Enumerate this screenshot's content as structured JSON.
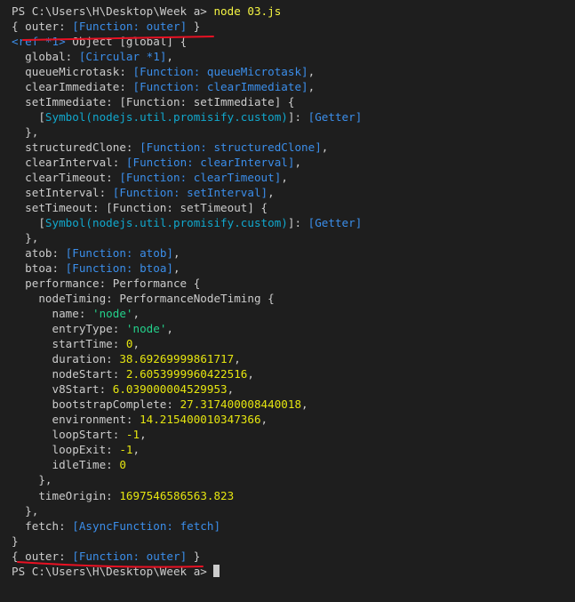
{
  "terminal": {
    "colors": {
      "background": "#1e1e1e",
      "text": "#cccccc",
      "function": "#3b8eea",
      "string": "#23d18b",
      "symbol": "#11a8cd",
      "number": "#e5e510",
      "annotation": "#e81123"
    },
    "prompt": "PS C:\\Users\\H\\Desktop\\Week a> ",
    "command": "node 03.js",
    "lines": [
      [
        [
          "",
          "PS C:\\Users\\H\\Desktop\\Week a> "
        ],
        [
          "cmd",
          "node 03.js"
        ]
      ],
      [
        [
          "",
          "{ outer: "
        ],
        [
          "c",
          "[Function: outer]"
        ],
        [
          "",
          " }"
        ]
      ],
      [
        [
          "c",
          "<ref *1>"
        ],
        [
          "",
          " Object [global] {"
        ]
      ],
      [
        [
          "",
          "  global: "
        ],
        [
          "c",
          "[Circular *1]"
        ],
        [
          "",
          ","
        ]
      ],
      [
        [
          "",
          "  queueMicrotask: "
        ],
        [
          "c",
          "[Function: queueMicrotask]"
        ],
        [
          "",
          ","
        ]
      ],
      [
        [
          "",
          "  clearImmediate: "
        ],
        [
          "c",
          "[Function: clearImmediate]"
        ],
        [
          "",
          ","
        ]
      ],
      [
        [
          "",
          "  setImmediate: [Function: setImmediate] {"
        ]
      ],
      [
        [
          "",
          "    ["
        ],
        [
          "t",
          "Symbol(nodejs.util.promisify.custom)"
        ],
        [
          "",
          "]: "
        ],
        [
          "c",
          "[Getter]"
        ]
      ],
      [
        [
          "",
          "  },"
        ]
      ],
      [
        [
          "",
          "  structuredClone: "
        ],
        [
          "c",
          "[Function: structuredClone]"
        ],
        [
          "",
          ","
        ]
      ],
      [
        [
          "",
          "  clearInterval: "
        ],
        [
          "c",
          "[Function: clearInterval]"
        ],
        [
          "",
          ","
        ]
      ],
      [
        [
          "",
          "  clearTimeout: "
        ],
        [
          "c",
          "[Function: clearTimeout]"
        ],
        [
          "",
          ","
        ]
      ],
      [
        [
          "",
          "  setInterval: "
        ],
        [
          "c",
          "[Function: setInterval]"
        ],
        [
          "",
          ","
        ]
      ],
      [
        [
          "",
          "  setTimeout: [Function: setTimeout] {"
        ]
      ],
      [
        [
          "",
          "    ["
        ],
        [
          "t",
          "Symbol(nodejs.util.promisify.custom)"
        ],
        [
          "",
          "]: "
        ],
        [
          "c",
          "[Getter]"
        ]
      ],
      [
        [
          "",
          "  },"
        ]
      ],
      [
        [
          "",
          "  atob: "
        ],
        [
          "c",
          "[Function: atob]"
        ],
        [
          "",
          ","
        ]
      ],
      [
        [
          "",
          "  btoa: "
        ],
        [
          "c",
          "[Function: btoa]"
        ],
        [
          "",
          ","
        ]
      ],
      [
        [
          "",
          "  performance: Performance {"
        ]
      ],
      [
        [
          "",
          "    nodeTiming: PerformanceNodeTiming {"
        ]
      ],
      [
        [
          "",
          "      name: "
        ],
        [
          "g",
          "'node'"
        ],
        [
          "",
          ","
        ]
      ],
      [
        [
          "",
          "      entryType: "
        ],
        [
          "g",
          "'node'"
        ],
        [
          "",
          ","
        ]
      ],
      [
        [
          "",
          "      startTime: "
        ],
        [
          "y",
          "0"
        ],
        [
          "",
          ","
        ]
      ],
      [
        [
          "",
          "      duration: "
        ],
        [
          "y",
          "38.69269999861717"
        ],
        [
          "",
          ","
        ]
      ],
      [
        [
          "",
          "      nodeStart: "
        ],
        [
          "y",
          "2.6053999960422516"
        ],
        [
          "",
          ","
        ]
      ],
      [
        [
          "",
          "      v8Start: "
        ],
        [
          "y",
          "6.039000004529953"
        ],
        [
          "",
          ","
        ]
      ],
      [
        [
          "",
          "      bootstrapComplete: "
        ],
        [
          "y",
          "27.317400008440018"
        ],
        [
          "",
          ","
        ]
      ],
      [
        [
          "",
          "      environment: "
        ],
        [
          "y",
          "14.215400010347366"
        ],
        [
          "",
          ","
        ]
      ],
      [
        [
          "",
          "      loopStart: "
        ],
        [
          "y",
          "-1"
        ],
        [
          "",
          ","
        ]
      ],
      [
        [
          "",
          "      loopExit: "
        ],
        [
          "y",
          "-1"
        ],
        [
          "",
          ","
        ]
      ],
      [
        [
          "",
          "      idleTime: "
        ],
        [
          "y",
          "0"
        ]
      ],
      [
        [
          "",
          "    },"
        ]
      ],
      [
        [
          "",
          "    timeOrigin: "
        ],
        [
          "y",
          "1697546586563.823"
        ]
      ],
      [
        [
          "",
          "  },"
        ]
      ],
      [
        [
          "",
          "  fetch: "
        ],
        [
          "c",
          "[AsyncFunction: fetch]"
        ]
      ],
      [
        [
          "",
          "}"
        ]
      ],
      [
        [
          "",
          "{ outer: "
        ],
        [
          "c",
          "[Function: outer]"
        ],
        [
          "",
          " }"
        ]
      ],
      [
        [
          "",
          "PS C:\\Users\\H\\Desktop\\Week a> "
        ],
        [
          "cursor",
          ""
        ]
      ]
    ]
  }
}
